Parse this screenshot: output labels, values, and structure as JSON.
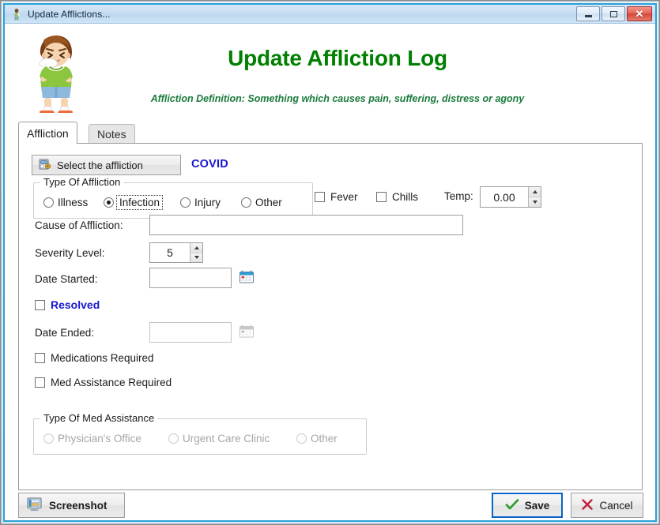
{
  "window": {
    "title": "Update Afflictions...",
    "title_icon": "person-icon",
    "minimize_label": "Minimize",
    "maximize_label": "Maximize",
    "close_label": "Close",
    "accent_color": "#29a3d8"
  },
  "header": {
    "icon": "sick-boy-sneezing-icon",
    "title": "Update Affliction Log",
    "title_color": "#008000",
    "subtitle": "Affliction Definition: Something which causes pain, suffering, distress or agony",
    "subtitle_color": "#1a7a3c"
  },
  "tabs": [
    {
      "label": "Affliction",
      "active": true
    },
    {
      "label": "Notes",
      "active": false
    }
  ],
  "affliction_tab": {
    "select_button": {
      "label": "Select the affliction",
      "icon": "select-database-icon"
    },
    "selected_affliction": "COVID",
    "selected_affliction_color": "#1717cf",
    "type_of_affliction": {
      "legend": "Type Of Affliction",
      "options": [
        {
          "label": "Illness",
          "selected": false
        },
        {
          "label": "Infection",
          "selected": true,
          "focused": true
        },
        {
          "label": "Injury",
          "selected": false
        },
        {
          "label": "Other",
          "selected": false
        }
      ]
    },
    "symptoms": [
      {
        "label": "Fever",
        "checked": false
      },
      {
        "label": "Chills",
        "checked": false
      }
    ],
    "temp": {
      "label": "Temp:",
      "value": "0.00"
    },
    "cause": {
      "label": "Cause of Affliction:",
      "value": "",
      "placeholder": ""
    },
    "severity": {
      "label": "Severity Level:",
      "value": "5"
    },
    "date_started": {
      "label": "Date Started:",
      "value": "",
      "placeholder": "",
      "picker_icon": "calendar-icon"
    },
    "resolved": {
      "label": "Resolved",
      "checked": false,
      "color": "#1717cf"
    },
    "date_ended": {
      "label": "Date Ended:",
      "value": "",
      "placeholder": "",
      "picker_icon": "calendar-icon",
      "disabled": true
    },
    "medications_required": {
      "label": "Medications Required",
      "checked": false
    },
    "med_assistance_required": {
      "label": "Med Assistance Required",
      "checked": false
    },
    "type_of_med_assistance": {
      "legend": "Type Of Med Assistance",
      "disabled": true,
      "options": [
        {
          "label": "Physician's Office",
          "selected": false
        },
        {
          "label": "Urgent Care Clinic",
          "selected": false
        },
        {
          "label": "Other",
          "selected": false
        }
      ]
    }
  },
  "footer": {
    "screenshot": {
      "label": "Screenshot",
      "icon": "monitor-screenshot-icon"
    },
    "save": {
      "label": "Save",
      "icon": "checkmark-icon",
      "icon_color": "#138808"
    },
    "cancel": {
      "label": "Cancel",
      "icon": "x-mark-icon",
      "icon_color": "#cc1f3d"
    }
  }
}
